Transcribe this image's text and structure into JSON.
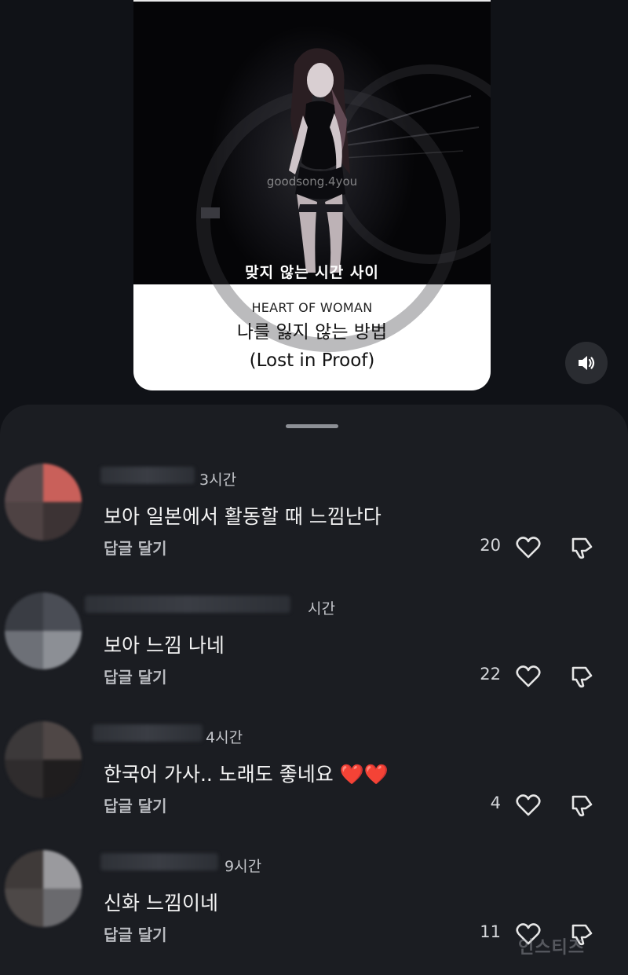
{
  "video": {
    "watermark": "goodsong.4you",
    "subtitle": "맞지 않는 시간 사이",
    "artist": "HEART OF WOMAN",
    "title_line1": "나를 잃지 않는 방법",
    "title_line2": "(Lost in Proof)"
  },
  "sound_button": {
    "icon": "speaker-icon"
  },
  "comments": [
    {
      "time": "3시간",
      "text": "보아 일본에서 활동할 때 느낌난다",
      "reply": "답글 달기",
      "likes": "20"
    },
    {
      "time": "시간",
      "text": "보아 느낌 나네",
      "reply": "답글 달기",
      "likes": "22"
    },
    {
      "time": "4시간",
      "text": "한국어 가사.. 노래도 좋네요 ❤️❤️",
      "reply": "답글 달기",
      "likes": "4"
    },
    {
      "time": "9시간",
      "text": "신화 느낌이네",
      "reply": "답글 달기",
      "likes": "11"
    }
  ],
  "corner_watermark": "인스티즈",
  "colors": {
    "background": "#101217",
    "sheet": "#1b1d22",
    "text": "#f4f4f4",
    "muted": "#b9bbc0"
  }
}
